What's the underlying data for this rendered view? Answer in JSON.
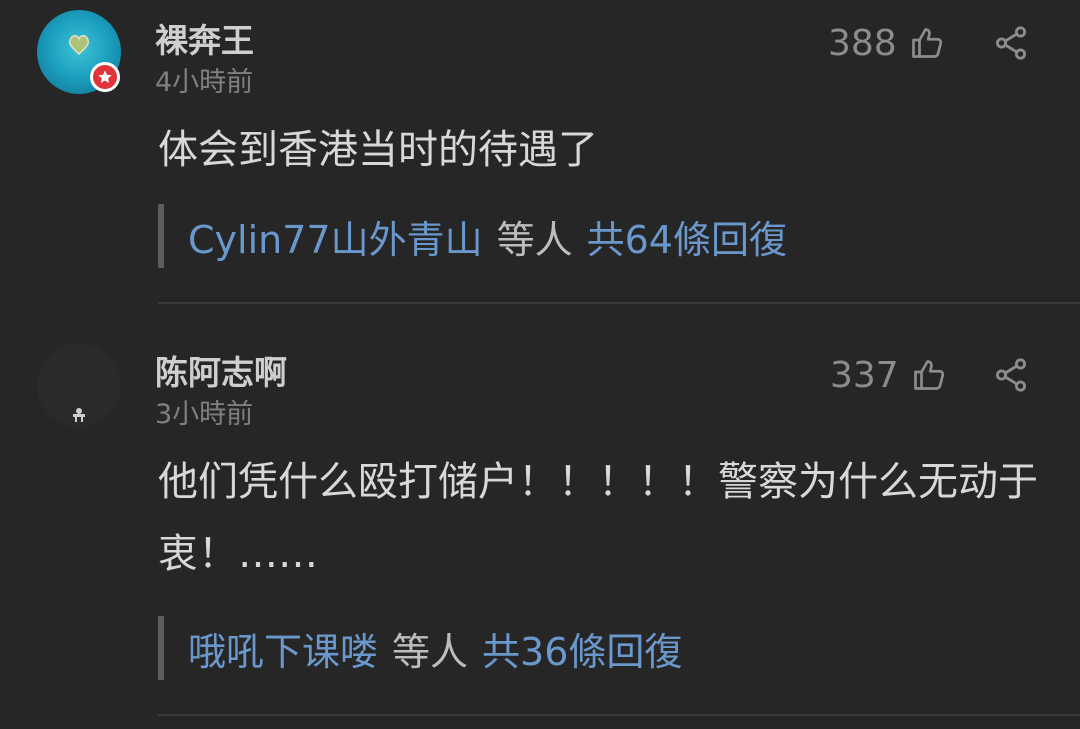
{
  "comments": [
    {
      "username": "裸奔王",
      "time": "4小時前",
      "likes": "388",
      "text": "体会到香港当时的待遇了",
      "reply": {
        "names": "Cylin77山外青山",
        "mid": "等人",
        "total": "共64條回復"
      },
      "avatar_icon": "heart-island-avatar",
      "badge_icon": "star-badge-icon"
    },
    {
      "username": "陈阿志啊",
      "time": "3小時前",
      "likes": "337",
      "text": "他们凭什么殴打储户！！！！！警察为什么无动于衷！……",
      "reply": {
        "names": "哦吼下课喽",
        "mid": "等人",
        "total": "共36條回復"
      },
      "avatar_icon": "dark-avatar"
    }
  ],
  "colors": {
    "background": "#262626",
    "link": "#6a98cc",
    "badge": "#e0343a"
  }
}
